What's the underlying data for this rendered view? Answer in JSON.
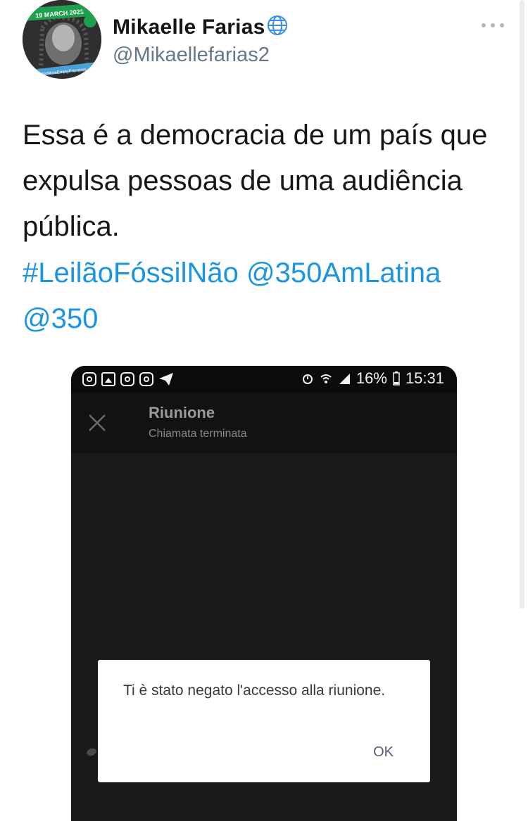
{
  "tweet": {
    "avatar": {
      "banner_text": "19 MARCH 2021",
      "caption_text": "#NoMoreEmptyPromises"
    },
    "display_name": "Mikaelle Farias",
    "handle": "@Mikaellefarias2",
    "text": "Essa é a democracia de um país que expulsa pessoas de uma audiência pública.",
    "hashtag": "#LeilãoFóssilNão",
    "mention_1": "@350AmLatina",
    "mention_2": "@350"
  },
  "embedded_screenshot": {
    "status_bar": {
      "battery": "16%",
      "time": "15:31"
    },
    "app_bar": {
      "title": "Riunione",
      "subtitle": "Chiamata terminata"
    },
    "dialog": {
      "message": "Ti è stato negato l'accesso alla riunione.",
      "ok_label": "OK"
    }
  },
  "colors": {
    "link": "#1b95e0",
    "text": "#14171a",
    "secondary": "#657786"
  }
}
